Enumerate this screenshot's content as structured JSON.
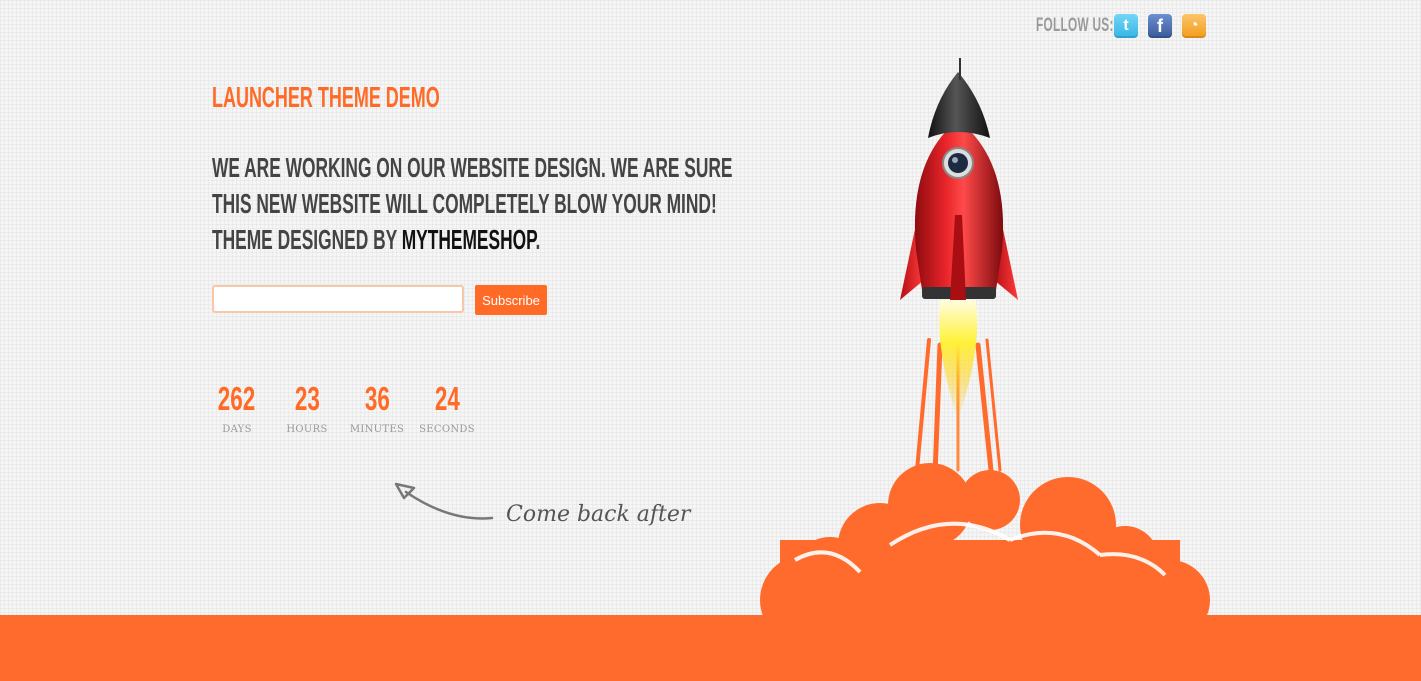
{
  "header": {
    "follow_label": "FOLLOW US:",
    "social": [
      {
        "icon": "twitter-icon",
        "glyph": "t"
      },
      {
        "icon": "facebook-icon",
        "glyph": "f"
      },
      {
        "icon": "rss-icon",
        "glyph": "◔"
      }
    ]
  },
  "main": {
    "title": "LAUNCHER THEME DEMO",
    "tagline_line1": "WE ARE WORKING ON OUR WEBSITE DESIGN. WE ARE SURE",
    "tagline_line2": "THIS NEW WEBSITE WILL COMPLETELY BLOW YOUR MIND!",
    "tagline_line3_prefix": "THEME DESIGNED BY ",
    "tagline_brand": "MYTHEMESHOP",
    "tagline_suffix": ".",
    "subscribe": {
      "email_value": "",
      "email_placeholder": "",
      "button_label": "Subscribe"
    },
    "countdown": [
      {
        "value": "262",
        "label": "DAYS"
      },
      {
        "value": "23",
        "label": "HOURS"
      },
      {
        "value": "36",
        "label": "MINUTES"
      },
      {
        "value": "24",
        "label": "SECONDS"
      }
    ],
    "come_back": "Come back after"
  },
  "colors": {
    "accent": "#ff6b27",
    "text_dark": "#444444",
    "rocket_red": "#d8161c",
    "cloud": "#ff6b2d"
  }
}
